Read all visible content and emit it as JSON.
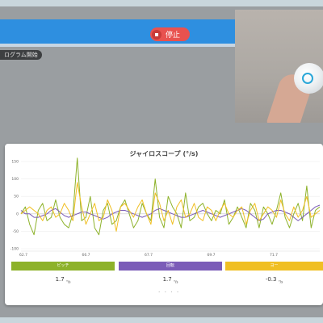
{
  "app": {
    "stop_label": "停止",
    "program_label": "ログラム開始"
  },
  "colors": {
    "header": "#2e8fe0",
    "stop": "#e8524f",
    "pitch": "#8db22a",
    "roll": "#7b5cb8",
    "yaw": "#f0bf23"
  },
  "chart_data": {
    "type": "line",
    "title": "ジャイロスコープ (°/s)",
    "xlabel": "",
    "ylabel": "",
    "ylim": [
      -100,
      150
    ],
    "yticks": [
      150,
      100,
      50,
      0,
      -50,
      -100
    ],
    "x_ticks": [
      "62.7",
      "66.7",
      "67.7",
      "69.7",
      "71.7"
    ],
    "grid": true,
    "series": [
      {
        "name": "ピッチ",
        "color": "#8db22a",
        "values": [
          0,
          20,
          -30,
          -60,
          10,
          30,
          -20,
          -10,
          40,
          -10,
          -30,
          -40,
          0,
          160,
          -20,
          -10,
          50,
          -40,
          -60,
          10,
          30,
          -30,
          -20,
          20,
          40,
          0,
          -40,
          -20,
          30,
          0,
          -20,
          100,
          -10,
          -40,
          50,
          20,
          0,
          -40,
          60,
          -20,
          -10,
          20,
          30,
          0,
          -20,
          10,
          0,
          40,
          -30,
          -10,
          20,
          -10,
          -40,
          30,
          10,
          -40,
          20,
          0,
          -30,
          10,
          60,
          -10,
          -40,
          0,
          30,
          -20,
          80,
          -40,
          10,
          20
        ]
      },
      {
        "name": "回転",
        "color": "#7b5cb8",
        "values": [
          10,
          0,
          0,
          -10,
          -10,
          -5,
          0,
          10,
          15,
          5,
          -5,
          -10,
          -5,
          0,
          5,
          5,
          0,
          -5,
          -10,
          -15,
          -10,
          0,
          5,
          10,
          10,
          5,
          0,
          -5,
          -10,
          -5,
          0,
          10,
          15,
          10,
          5,
          0,
          -5,
          -10,
          -10,
          -5,
          0,
          5,
          10,
          5,
          0,
          -5,
          -10,
          -5,
          0,
          5,
          10,
          15,
          10,
          0,
          -10,
          -20,
          -15,
          0,
          5,
          10,
          10,
          5,
          0,
          -10,
          -20,
          -10,
          0,
          10,
          20,
          25
        ]
      },
      {
        "name": "ヨー",
        "color": "#f0bf23",
        "values": [
          0,
          10,
          20,
          10,
          0,
          -20,
          10,
          20,
          -10,
          0,
          30,
          10,
          -20,
          90,
          20,
          -30,
          0,
          30,
          -20,
          -10,
          40,
          10,
          -50,
          20,
          30,
          10,
          -10,
          20,
          40,
          0,
          -30,
          60,
          30,
          -20,
          10,
          -30,
          20,
          40,
          -10,
          0,
          30,
          -10,
          -20,
          20,
          10,
          -20,
          10,
          30,
          0,
          -10,
          10,
          20,
          -30,
          10,
          30,
          -20,
          0,
          20,
          10,
          -10,
          40,
          0,
          -20,
          20,
          -10,
          10,
          50,
          -10,
          0,
          10
        ]
      }
    ]
  },
  "readings": [
    {
      "label": "ピッチ",
      "value": "1.7",
      "unit": "°/s"
    },
    {
      "label": "回転",
      "value": "1.7",
      "unit": "°/s"
    },
    {
      "label": "ヨー",
      "value": "-0.3",
      "unit": "°/s"
    }
  ],
  "pager": "• • • •"
}
